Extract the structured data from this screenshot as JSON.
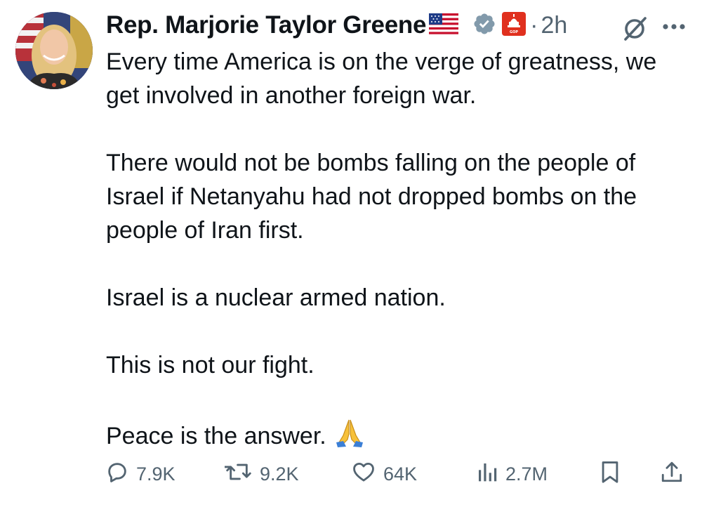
{
  "author": {
    "display_name": "Rep. Marjorie Taylor Greene",
    "verified": true,
    "affiliation_badge_text": "GOP"
  },
  "timestamp": "2h",
  "separator": "·",
  "tweet": {
    "paragraphs": [
      "Every time America is on the verge of greatness, we get involved in another foreign war.",
      "There would not be bombs falling on the people of Israel if Netanyahu had not dropped bombs on the people of Iran first.",
      "Israel is a nuclear armed nation.",
      "This is not our fight.",
      "Peace is the answer."
    ],
    "trailing_emoji": "folded-hands"
  },
  "metrics": {
    "replies": "7.9K",
    "reposts": "9.2K",
    "likes": "64K",
    "views": "2.7M"
  },
  "colors": {
    "text": "#0f1419",
    "secondary": "#536471",
    "verified_badge": "#829aab",
    "gop_badge": "#e0301e"
  },
  "icons": [
    "flag-us-icon",
    "verified-icon",
    "gop-badge-icon",
    "grok-icon",
    "more-icon",
    "reply-icon",
    "repost-icon",
    "like-icon",
    "views-icon",
    "bookmark-icon",
    "share-icon",
    "folded-hands-icon"
  ]
}
